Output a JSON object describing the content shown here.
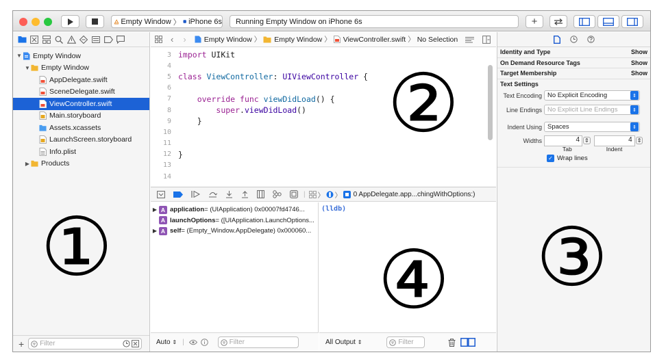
{
  "toolbar": {
    "scheme_name": "Empty Window",
    "device_name": "iPhone 6s",
    "activity_status": "Running Empty Window on iPhone 6s",
    "add_label": "+",
    "back_forward_label": "↩"
  },
  "navigator": {
    "tree": [
      {
        "label": "Empty Window",
        "indent": 0,
        "disclosure": "▼",
        "icon": "project-icon",
        "selected": false
      },
      {
        "label": "Empty Window",
        "indent": 1,
        "disclosure": "▼",
        "icon": "folder-icon",
        "selected": false
      },
      {
        "label": "AppDelegate.swift",
        "indent": 2,
        "disclosure": "",
        "icon": "swift-file-icon",
        "selected": false
      },
      {
        "label": "SceneDelegate.swift",
        "indent": 2,
        "disclosure": "",
        "icon": "swift-file-icon",
        "selected": false
      },
      {
        "label": "ViewController.swift",
        "indent": 2,
        "disclosure": "",
        "icon": "swift-file-icon",
        "selected": true
      },
      {
        "label": "Main.storyboard",
        "indent": 2,
        "disclosure": "",
        "icon": "storyboard-icon",
        "selected": false
      },
      {
        "label": "Assets.xcassets",
        "indent": 2,
        "disclosure": "",
        "icon": "assets-icon",
        "selected": false
      },
      {
        "label": "LaunchScreen.storyboard",
        "indent": 2,
        "disclosure": "",
        "icon": "storyboard-icon",
        "selected": false
      },
      {
        "label": "Info.plist",
        "indent": 2,
        "disclosure": "",
        "icon": "plist-icon",
        "selected": false
      },
      {
        "label": "Products",
        "indent": 0,
        "disclosure": "▶",
        "icon": "folder-icon",
        "selected": false
      }
    ],
    "filter_placeholder": "Filter",
    "add_label": "+"
  },
  "editor": {
    "breadcrumb": [
      "Empty Window",
      "Empty Window",
      "ViewController.swift",
      "No Selection"
    ],
    "code_lines": [
      {
        "num": "3",
        "tokens": [
          {
            "t": "import",
            "c": "kw"
          },
          {
            "t": " UIKit",
            "c": ""
          }
        ]
      },
      {
        "num": "4",
        "tokens": []
      },
      {
        "num": "5",
        "tokens": [
          {
            "t": "class",
            "c": "kw"
          },
          {
            "t": " ViewController",
            "c": "fn"
          },
          {
            "t": ": ",
            "c": ""
          },
          {
            "t": "UIViewController",
            "c": "ty"
          },
          {
            "t": " {",
            "c": ""
          }
        ]
      },
      {
        "num": "6",
        "tokens": []
      },
      {
        "num": "7",
        "tokens": [
          {
            "t": "    ",
            "c": ""
          },
          {
            "t": "override",
            "c": "kw"
          },
          {
            "t": " ",
            "c": ""
          },
          {
            "t": "func",
            "c": "kw"
          },
          {
            "t": " viewDidLoad",
            "c": "fn"
          },
          {
            "t": "() {",
            "c": ""
          }
        ]
      },
      {
        "num": "8",
        "tokens": [
          {
            "t": "        ",
            "c": ""
          },
          {
            "t": "super",
            "c": "kw"
          },
          {
            "t": ".",
            "c": ""
          },
          {
            "t": "viewDidLoad",
            "c": "ty"
          },
          {
            "t": "()",
            "c": ""
          }
        ]
      },
      {
        "num": "9",
        "tokens": [
          {
            "t": "    }",
            "c": ""
          }
        ]
      },
      {
        "num": "10",
        "tokens": []
      },
      {
        "num": "11",
        "tokens": []
      },
      {
        "num": "12",
        "tokens": [
          {
            "t": "}",
            "c": ""
          }
        ]
      },
      {
        "num": "13",
        "tokens": []
      },
      {
        "num": "14",
        "tokens": []
      }
    ]
  },
  "debug": {
    "frame_label": "0 AppDelegate.app...chingWithOptions:)",
    "variables": [
      {
        "disclosure": "▶",
        "badge": "A",
        "name": "application",
        "value": " = (UIApplication) 0x00007fd4746..."
      },
      {
        "disclosure": "",
        "badge": "A",
        "name": "launchOptions",
        "value": " = ([UIApplication.LaunchOptions..."
      },
      {
        "disclosure": "▶",
        "badge": "A",
        "name": "self",
        "value": " = (Empty_Window.AppDelegate) 0x000060..."
      }
    ],
    "console_prompt": "(lldb)",
    "auto_label": "Auto",
    "output_label": "All Output",
    "filter_placeholder": "Filter"
  },
  "inspector": {
    "sections": [
      {
        "title": "Identity and Type",
        "action": "Show"
      },
      {
        "title": "On Demand Resource Tags",
        "action": "Show"
      },
      {
        "title": "Target Membership",
        "action": "Show"
      }
    ],
    "text_settings": {
      "title": "Text Settings",
      "encoding_label": "Text Encoding",
      "encoding_value": "No Explicit Encoding",
      "line_endings_label": "Line Endings",
      "line_endings_value": "No Explicit Line Endings",
      "indent_using_label": "Indent Using",
      "indent_using_value": "Spaces",
      "widths_label": "Widths",
      "tab_value": "4",
      "indent_value": "4",
      "tab_label": "Tab",
      "indent_label": "Indent",
      "wrap_lines_label": "Wrap lines",
      "wrap_lines_checked": true
    }
  },
  "annotations": [
    "①",
    "②",
    "③",
    "④"
  ],
  "colors": {
    "accent": "#1c62d6",
    "close": "#fd5f57",
    "minimize": "#febc2e",
    "zoom": "#28c840",
    "keyword": "#9b2393",
    "type": "#3900a0"
  }
}
